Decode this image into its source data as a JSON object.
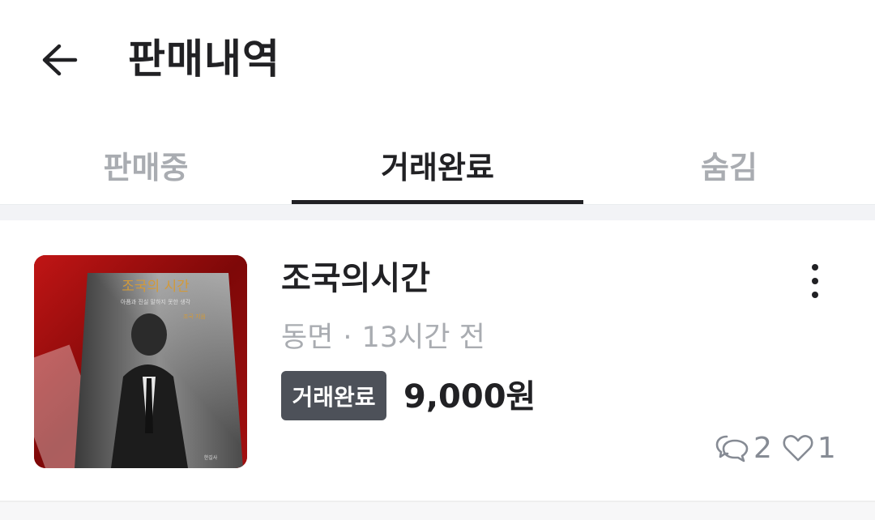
{
  "header": {
    "title": "판매내역"
  },
  "tabs": [
    {
      "label": "판매중",
      "active": false
    },
    {
      "label": "거래완료",
      "active": true
    },
    {
      "label": "숨김",
      "active": false
    }
  ],
  "item": {
    "title": "조국의시간",
    "location": "동면",
    "time_ago": "13시간 전",
    "status": "거래완료",
    "price": "9,000원",
    "chat_count": "2",
    "like_count": "1",
    "thumbnail": {
      "cover_title": "조국의 시간",
      "cover_subtitle": "아픔과 진실 말하지 못한 생각",
      "cover_author": "조국 지음",
      "cover_publisher": "한길사"
    }
  },
  "colors": {
    "text_primary": "#212124",
    "text_muted": "#a9acb1",
    "badge_bg": "#4d5159",
    "thumb_bg": "#8a0d0d"
  }
}
